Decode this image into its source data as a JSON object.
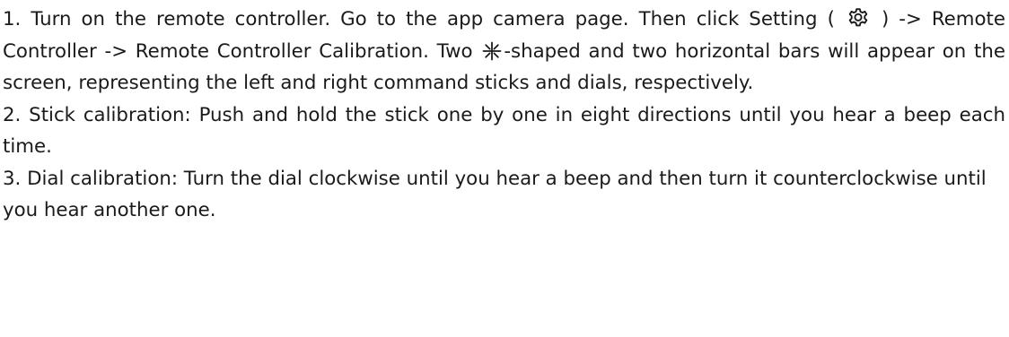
{
  "steps": [
    {
      "num": "1.",
      "seg1": " Turn on the remote controller. Go to the app camera page. Then click Setting ( ",
      "icon": "gear-icon",
      "seg2": " ) -> Remote Controller -> Remote Controller Calibration. Two ",
      "icon2": "asterisk-cross-icon",
      "seg3": "-shaped and two horizontal bars will appear on the screen, representing the left and right command sticks and dials, respectively."
    },
    {
      "num": "2.",
      "text": "  Stick calibration: Push and hold the stick one by one in eight directions until you hear a beep each time."
    },
    {
      "num": "3.",
      "text": " Dial calibration: Turn the dial clockwise until you hear a beep and then turn it counterclockwise until you hear another one."
    }
  ]
}
